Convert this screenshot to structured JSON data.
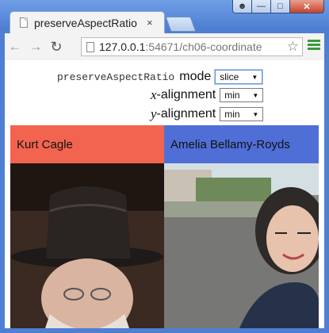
{
  "window": {
    "controls": [
      "user",
      "minimize",
      "maximize",
      "close"
    ]
  },
  "tab": {
    "title": "preserveAspectRatio",
    "close_glyph": "×"
  },
  "toolbar": {
    "back_icon": "back-arrow-icon",
    "forward_icon": "forward-arrow-icon",
    "reload_icon": "reload-icon",
    "url_host": "127.0.0.1",
    "url_rest": ":54671/ch06-coordinate",
    "star_icon": "star-icon",
    "menu_icon": "menu-icon"
  },
  "page": {
    "mode_code": "preserveAspectRatio",
    "mode_label": "mode",
    "mode_value": "slice",
    "x_var": "x",
    "x_label": "-alignment",
    "x_value": "min",
    "y_var": "y",
    "y_label": "-alignment",
    "y_value": "min",
    "panels": [
      {
        "name": "Kurt Cagle",
        "color": "#f2644f"
      },
      {
        "name": "Amelia Bellamy-Royds",
        "color": "#4f6fd6"
      }
    ]
  }
}
